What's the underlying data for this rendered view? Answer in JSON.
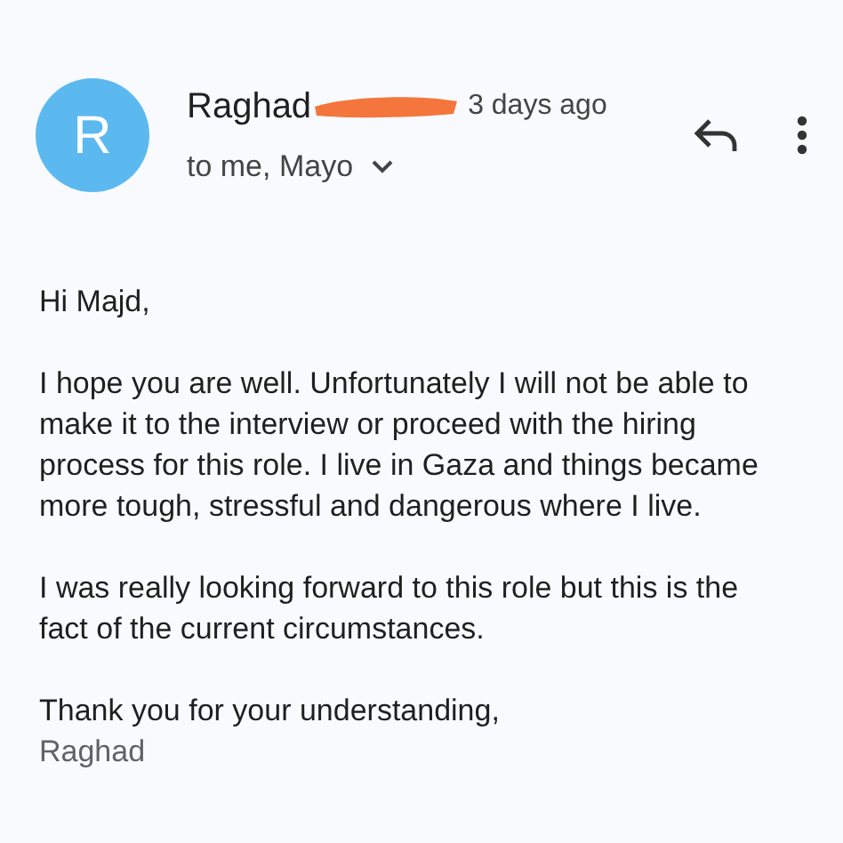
{
  "sender": {
    "avatar_letter": "R",
    "name": "Raghad",
    "redacted": true,
    "time": "3 days ago"
  },
  "recipients": "to me, Mayo",
  "body": [
    "Hi Majd,",
    "I hope you are well. Unfortunately I will not be able to make it to the interview or proceed with the hiring process for this role. I live in Gaza and things became more tough, stressful and dangerous where I live.",
    "I was really looking forward to this role but this is the fact of the current circumstances.",
    "Thank you for your understanding,"
  ],
  "signature": "Raghad"
}
